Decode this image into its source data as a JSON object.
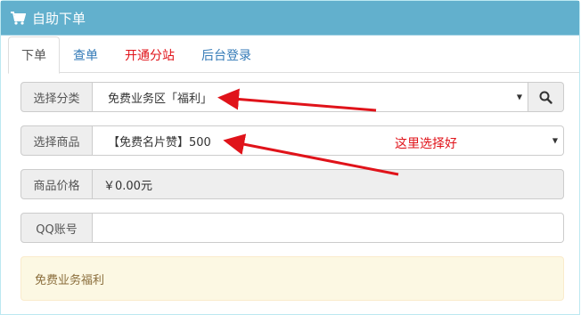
{
  "header": {
    "title": "自助下单",
    "icon": "cart-icon"
  },
  "tabs": [
    {
      "label": "下单",
      "active": true
    },
    {
      "label": "查单"
    },
    {
      "label": "开通分站",
      "color": "#e0131a"
    },
    {
      "label": "后台登录"
    }
  ],
  "form": {
    "category": {
      "label": "选择分类",
      "value": "免费业务区「福利」"
    },
    "product": {
      "label": "选择商品",
      "value": "【免费名片赞】500"
    },
    "price": {
      "label": "商品价格",
      "value": "￥0.00元"
    },
    "qq": {
      "label": "QQ账号",
      "value": ""
    }
  },
  "notice": {
    "text": "免费业务福利"
  },
  "annotation": {
    "text": "这里选择好",
    "color": "#e0131a"
  }
}
